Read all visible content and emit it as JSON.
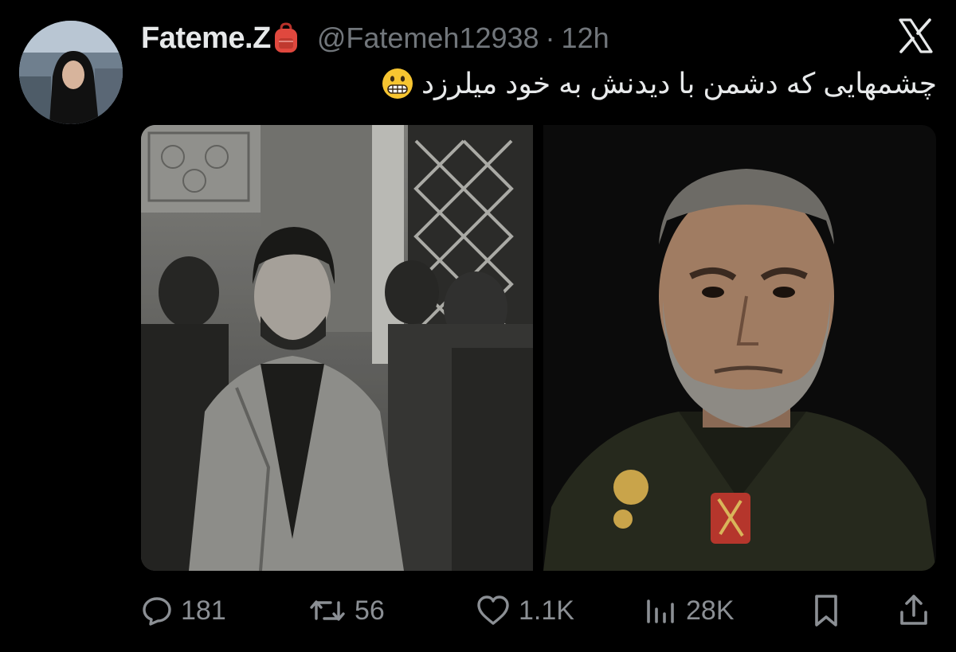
{
  "author": {
    "display_name": "Fateme.Z",
    "badge_icon": "backpack-icon",
    "handle": "@Fatemeh12938",
    "separator": "·",
    "time_ago": "12h"
  },
  "platform_logo": "x-logo-icon",
  "tweet": {
    "text": "چشمهایی که دشمن با دیدنش به خود میلرزد",
    "emoji": "grimacing-face-emoji"
  },
  "media": {
    "images": [
      {
        "name": "historical-photo",
        "style": "black-and-white"
      },
      {
        "name": "portrait-photo",
        "style": "color"
      }
    ]
  },
  "actions": {
    "reply": {
      "icon": "reply-icon",
      "count": "181"
    },
    "repost": {
      "icon": "repost-icon",
      "count": "56"
    },
    "like": {
      "icon": "heart-icon",
      "count": "1.1K"
    },
    "views": {
      "icon": "views-icon",
      "count": "28K"
    },
    "bookmark": {
      "icon": "bookmark-icon"
    },
    "share": {
      "icon": "share-icon"
    }
  },
  "colors": {
    "background": "#000000",
    "primary_text": "#e7e9ea",
    "secondary_text": "#71767b",
    "action_icons": "#8b8f94",
    "badge": "#e0483e"
  }
}
